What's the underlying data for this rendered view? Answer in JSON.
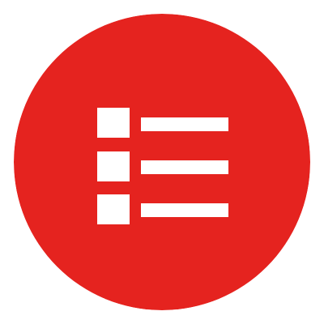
{
  "app_icon": {
    "icon": "list-icon",
    "background_color": "#e5231f",
    "glyph_color": "#ffffff",
    "row_count": 3
  }
}
